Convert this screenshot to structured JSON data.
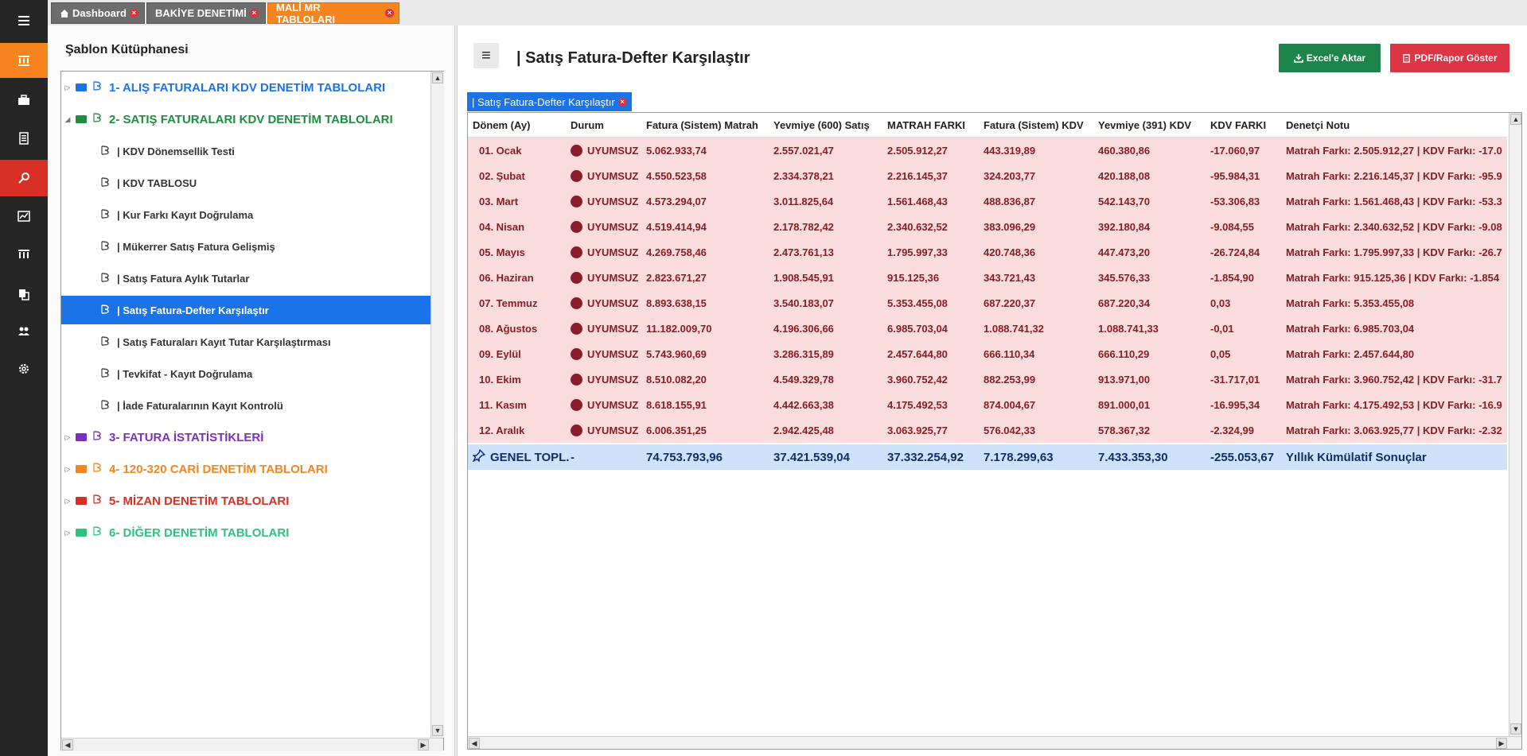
{
  "nav": {
    "icons": [
      "hamburger-icon",
      "bank-icon",
      "briefcase-icon",
      "ledger-icon",
      "search-icon",
      "chart-icon",
      "building-icon",
      "documents-icon",
      "users-icon",
      "gear-icon"
    ],
    "active_color": "#f6841f",
    "search_color": "#d93025"
  },
  "top_tabs": [
    {
      "label": "Dashboard"
    },
    {
      "label": "BAKİYE DENETİMİ"
    },
    {
      "label": "MALİ MR TABLOLARI"
    }
  ],
  "library": {
    "title": "Şablon Kütüphanesi",
    "categories": [
      {
        "label": "1- ALIŞ FATURALARI KDV DENETİM TABLOLARI",
        "color": "#1a73e8"
      },
      {
        "label": "2- SATIŞ FATURALARI KDV DENETİM TABLOLARI",
        "color": "#1e8e3e"
      },
      {
        "label": "3- FATURA İSTATİSTİKLERİ",
        "color": "#7b2fbe"
      },
      {
        "label": "4- 120-320 CARİ DENETİM TABLOLARI",
        "color": "#f6841f"
      },
      {
        "label": "5- MİZAN DENETİM TABLOLARI",
        "color": "#d93025"
      },
      {
        "label": "6- DİĞER DENETİM TABLOLARI",
        "color": "#2ec27e"
      }
    ],
    "children": [
      "| KDV Dönemsellik Testi",
      "| KDV TABLOSU",
      "| Kur Farkı Kayıt Doğrulama",
      "| Mükerrer Satış Fatura Gelişmiş",
      "| Satış Fatura Aylık Tutarlar",
      "| Satış Fatura-Defter Karşılaştır",
      "| Satış Faturaları Kayıt Tutar Karşılaştırması",
      "| Tevkifat - Kayıt Doğrulama",
      "| İade Faturalarının Kayıt Kontrolü"
    ]
  },
  "main": {
    "title": "| Satış Fatura-Defter Karşılaştır",
    "excel_label": "Excel'e Aktar",
    "pdf_label": "PDF/Rapor Göster",
    "excel_color": "#1e8449",
    "pdf_color": "#dc3545",
    "sub_tab": "| Satış Fatura-Defter Karşılaştır"
  },
  "grid": {
    "headers": [
      "Dönem (Ay)",
      "Durum",
      "Fatura (Sistem) Matrah",
      "Yevmiye (600) Satış",
      "MATRAH FARKI",
      "Fatura (Sistem) KDV",
      "Yevmiye (391) KDV",
      "KDV FARKI",
      "Denetçi Notu"
    ],
    "rows": [
      [
        "01. Ocak",
        "UYUMSUZ",
        "5.062.933,74",
        "2.557.021,47",
        "2.505.912,27",
        "443.319,89",
        "460.380,86",
        "-17.060,97",
        "Matrah Farkı: 2.505.912,27 | KDV Farkı: -17.0"
      ],
      [
        "02. Şubat",
        "UYUMSUZ",
        "4.550.523,58",
        "2.334.378,21",
        "2.216.145,37",
        "324.203,77",
        "420.188,08",
        "-95.984,31",
        "Matrah Farkı: 2.216.145,37 | KDV Farkı: -95.9"
      ],
      [
        "03. Mart",
        "UYUMSUZ",
        "4.573.294,07",
        "3.011.825,64",
        "1.561.468,43",
        "488.836,87",
        "542.143,70",
        "-53.306,83",
        "Matrah Farkı: 1.561.468,43 | KDV Farkı: -53.3"
      ],
      [
        "04. Nisan",
        "UYUMSUZ",
        "4.519.414,94",
        "2.178.782,42",
        "2.340.632,52",
        "383.096,29",
        "392.180,84",
        "-9.084,55",
        "Matrah Farkı: 2.340.632,52 | KDV Farkı: -9.08"
      ],
      [
        "05. Mayıs",
        "UYUMSUZ",
        "4.269.758,46",
        "2.473.761,13",
        "1.795.997,33",
        "420.748,36",
        "447.473,20",
        "-26.724,84",
        "Matrah Farkı: 1.795.997,33 | KDV Farkı: -26.7"
      ],
      [
        "06. Haziran",
        "UYUMSUZ",
        "2.823.671,27",
        "1.908.545,91",
        "915.125,36",
        "343.721,43",
        "345.576,33",
        "-1.854,90",
        "Matrah Farkı: 915.125,36 | KDV Farkı: -1.854"
      ],
      [
        "07. Temmuz",
        "UYUMSUZ",
        "8.893.638,15",
        "3.540.183,07",
        "5.353.455,08",
        "687.220,37",
        "687.220,34",
        "0,03",
        "Matrah Farkı: 5.353.455,08"
      ],
      [
        "08. Ağustos",
        "UYUMSUZ",
        "11.182.009,70",
        "4.196.306,66",
        "6.985.703,04",
        "1.088.741,32",
        "1.088.741,33",
        "-0,01",
        "Matrah Farkı: 6.985.703,04"
      ],
      [
        "09. Eylül",
        "UYUMSUZ",
        "5.743.960,69",
        "3.286.315,89",
        "2.457.644,80",
        "666.110,34",
        "666.110,29",
        "0,05",
        "Matrah Farkı: 2.457.644,80"
      ],
      [
        "10. Ekim",
        "UYUMSUZ",
        "8.510.082,20",
        "4.549.329,78",
        "3.960.752,42",
        "882.253,99",
        "913.971,00",
        "-31.717,01",
        "Matrah Farkı: 3.960.752,42 | KDV Farkı: -31.7"
      ],
      [
        "11. Kasım",
        "UYUMSUZ",
        "8.618.155,91",
        "4.442.663,38",
        "4.175.492,53",
        "874.004,67",
        "891.000,01",
        "-16.995,34",
        "Matrah Farkı: 4.175.492,53 | KDV Farkı: -16.9"
      ],
      [
        "12. Aralık",
        "UYUMSUZ",
        "6.006.351,25",
        "2.942.425,48",
        "3.063.925,77",
        "576.042,33",
        "578.367,32",
        "-2.324,99",
        "Matrah Farkı: 3.063.925,77 | KDV Farkı: -2.32"
      ]
    ],
    "total": [
      "GENEL TOPL.",
      "-",
      "74.753.793,96",
      "37.421.539,04",
      "37.332.254,92",
      "7.178.299,63",
      "7.433.353,30",
      "-255.053,67",
      "Yıllık Kümülatif Sonuçlar"
    ],
    "row_color": "#fadbde",
    "total_color": "#cfe2fb",
    "status_color": "#8b1c2a"
  }
}
